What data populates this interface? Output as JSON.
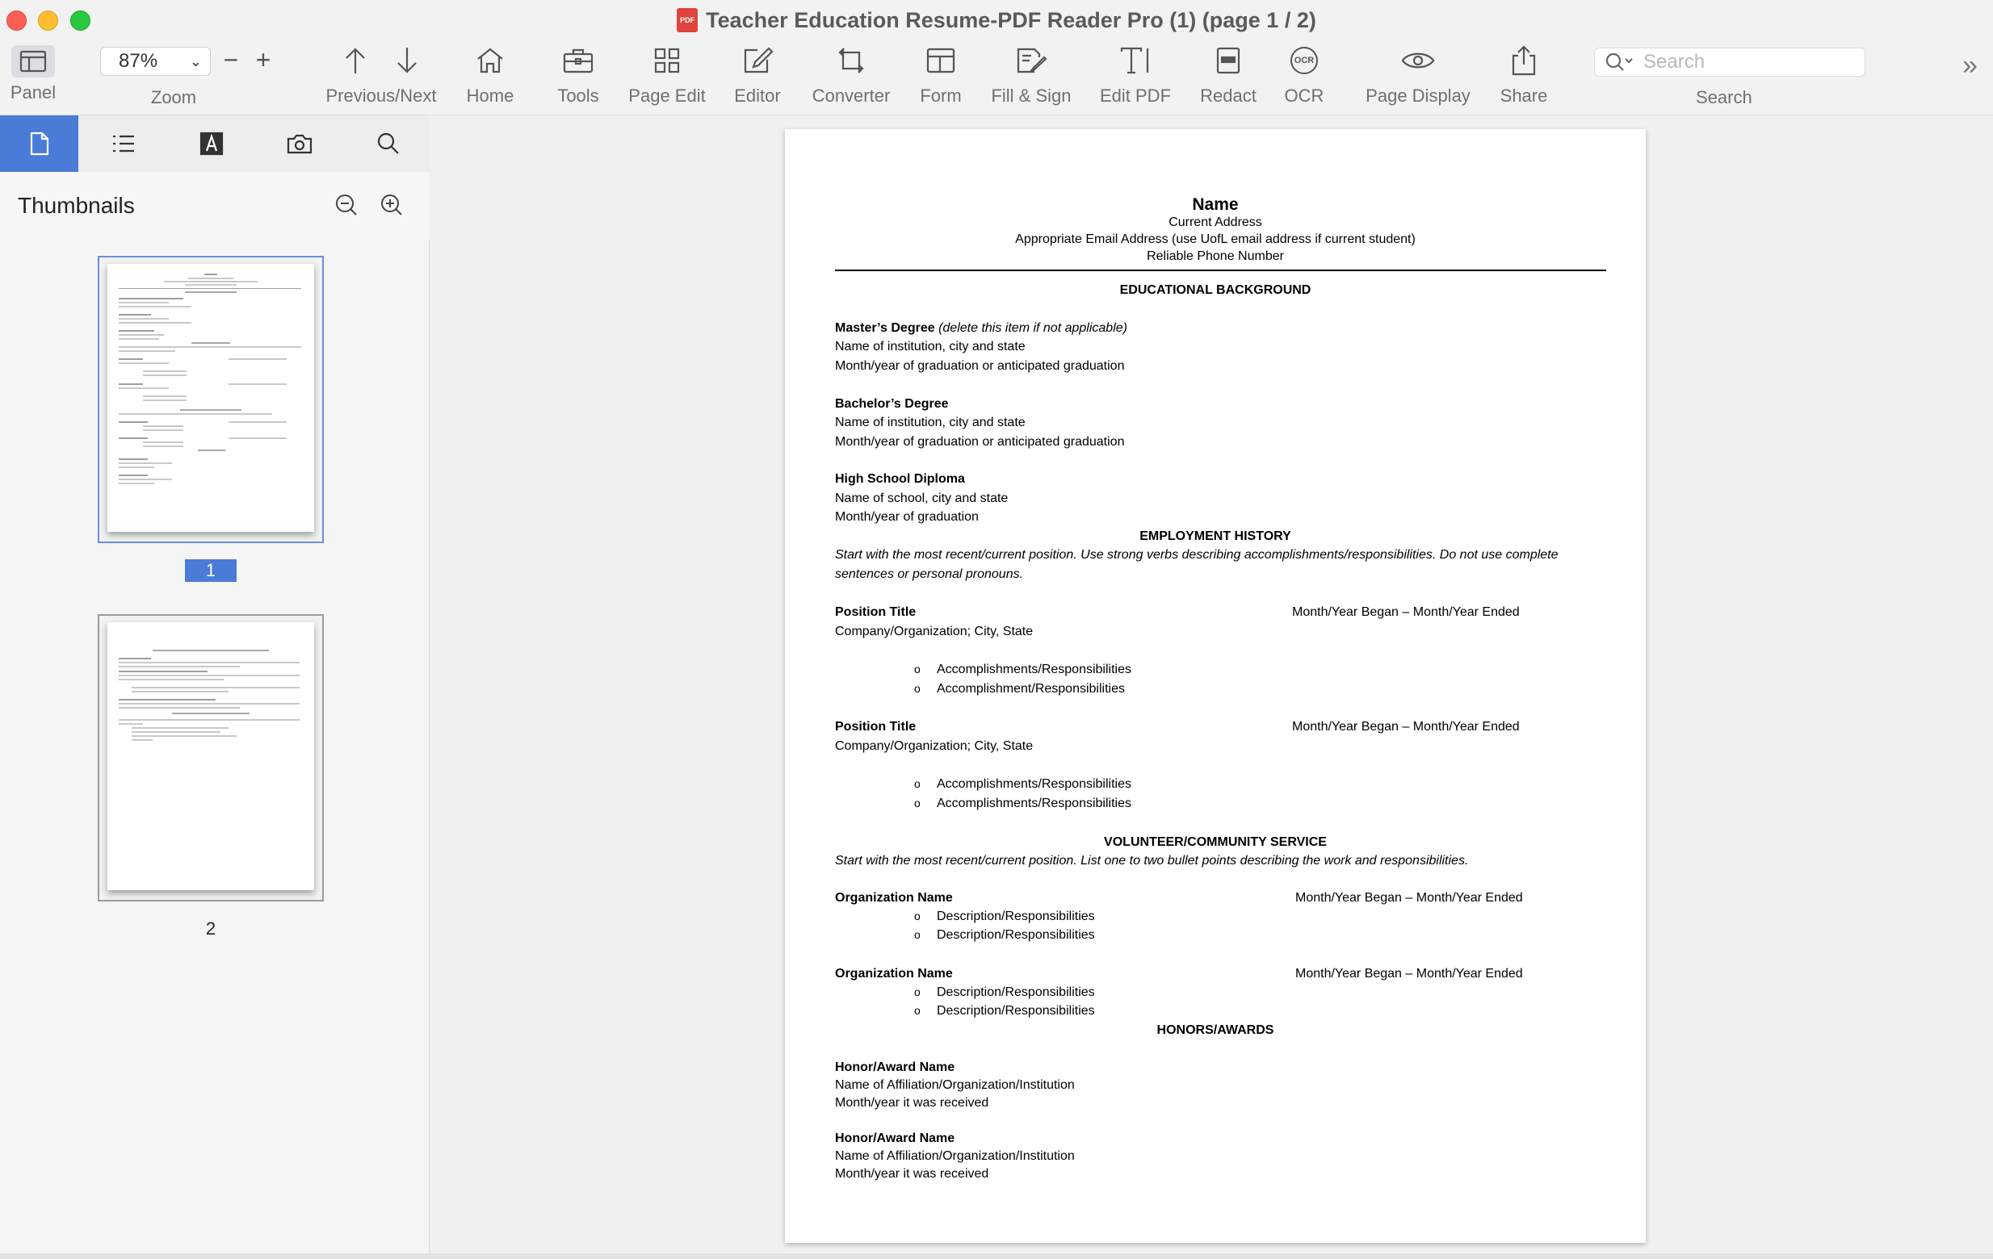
{
  "window": {
    "title": "Teacher Education Resume-PDF Reader Pro (1) (page 1 / 2)",
    "file_icon_text": "PDF"
  },
  "toolbar": {
    "panel": "Panel",
    "zoom_value": "87%",
    "zoom_label": "Zoom",
    "zoom_minus": "−",
    "zoom_plus": "+",
    "prev_next": "Previous/Next",
    "home": "Home",
    "tools": "Tools",
    "page_edit": "Page Edit",
    "editor": "Editor",
    "converter": "Converter",
    "form": "Form",
    "fill_sign": "Fill & Sign",
    "edit_pdf": "Edit PDF",
    "redact": "Redact",
    "ocr": "OCR",
    "ocr_glyph": "OCR",
    "page_display": "Page Display",
    "share": "Share",
    "search_placeholder": "Search",
    "search_label": "Search",
    "overflow": "»"
  },
  "sidebar": {
    "tabs": [
      "thumbnails-tab",
      "outline-tab",
      "annotations-tab",
      "snapshot-tab",
      "search-tab"
    ],
    "header": "Thumbnails",
    "pages": [
      {
        "number": "1",
        "selected": true
      },
      {
        "number": "2",
        "selected": false
      }
    ]
  },
  "document": {
    "name": "Name",
    "current_address": "Current Address",
    "email": "Appropriate Email Address (use UofL email address if current student)",
    "phone": "Reliable Phone Number",
    "edu_heading": "EDUCATIONAL BACKGROUND",
    "masters_title": "Master’s Degree",
    "masters_note": "(delete this item if not applicable)",
    "masters_inst": "Name of institution, city and state",
    "masters_grad": "Month/year of graduation or anticipated graduation",
    "bachelors_title": "Bachelor’s Degree",
    "bachelors_inst": "Name of institution, city and state",
    "bachelors_grad": "Month/year of graduation or anticipated graduation",
    "hs_title": "High School Diploma",
    "hs_inst": "Name of school, city and state",
    "hs_grad": "Month/year of graduation",
    "emp_heading": "EMPLOYMENT HISTORY",
    "emp_instr_1": "Start with the most recent/current position. Use strong verbs describing accomplishments/responsibilities. Do not use complete",
    "emp_instr_2": "sentences or personal pronouns.",
    "positions": [
      {
        "title": "Position Title",
        "dates": "Month/Year Began – Month/Year Ended",
        "company": "Company/Organization; City, State",
        "bullets": [
          "Accomplishments/Responsibilities",
          "Accomplishment/Responsibilities"
        ]
      },
      {
        "title": "Position Title",
        "dates": "Month/Year Began – Month/Year Ended",
        "company": "Company/Organization; City, State",
        "bullets": [
          "Accomplishments/Responsibilities",
          "Accomplishments/Responsibilities"
        ]
      }
    ],
    "vol_heading": "VOLUNTEER/COMMUNITY SERVICE",
    "vol_instr": "Start with the most recent/current position. List one to two bullet points describing the work and responsibilities.",
    "organizations": [
      {
        "name": "Organization Name",
        "dates": "Month/Year Began – Month/Year Ended",
        "bullets": [
          "Description/Responsibilities",
          "Description/Responsibilities"
        ]
      },
      {
        "name": "Organization Name",
        "dates": "Month/Year Began – Month/Year Ended",
        "bullets": [
          "Description/Responsibilities",
          "Description/Responsibilities"
        ]
      }
    ],
    "honors_heading": "HONORS/AWARDS",
    "honors": [
      {
        "name": "Honor/Award Name",
        "affiliation": "Name of Affiliation/Organization/Institution",
        "received": "Month/year it was received"
      },
      {
        "name": "Honor/Award Name",
        "affiliation": "Name of Affiliation/Organization/Institution",
        "received": "Month/year it was received"
      }
    ],
    "bullet_glyph": "o"
  },
  "colors": {
    "accent": "#4a7bd6",
    "chrome": "#f2f2f2",
    "viewer_bg": "#f0f0f0"
  }
}
